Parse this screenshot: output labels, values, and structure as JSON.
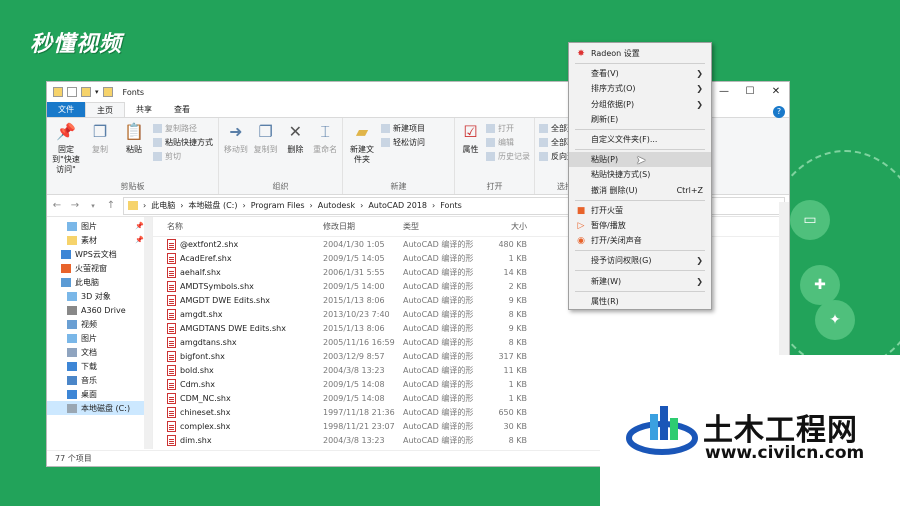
{
  "brand": "秒懂视频",
  "watermark": {
    "title": "土木工程网",
    "url": "www.civilcn.com"
  },
  "window": {
    "title": "Fonts",
    "controls": {
      "minimize": "—",
      "maximize": "☐",
      "close": "✕"
    },
    "tabs": [
      "文件",
      "主页",
      "共享",
      "查看"
    ],
    "ribbon": {
      "clipboard": {
        "name": "剪贴板",
        "pin": "固定到\"快速访问\"",
        "copy": "复制",
        "paste": "粘贴",
        "cut": "剪切",
        "copy_path": "复制路径",
        "paste_shortcut": "粘贴快捷方式"
      },
      "organize": {
        "name": "组织",
        "move_to": "移动到",
        "copy_to": "复制到",
        "delete": "删除",
        "rename": "重命名"
      },
      "new": {
        "name": "新建",
        "new_folder": "新建文件夹",
        "new_item": "新建项目",
        "easy_access": "轻松访问"
      },
      "open": {
        "name": "打开",
        "properties": "属性",
        "open": "打开",
        "edit": "编辑",
        "history": "历史记录"
      },
      "select": {
        "name": "选择",
        "select_all": "全部选择",
        "select_none": "全部取消",
        "invert": "反向选择"
      }
    },
    "address": [
      "此电脑",
      "本地磁盘 (C:)",
      "Program Files",
      "Autodesk",
      "AutoCAD 2018",
      "Fonts"
    ],
    "sidebar": [
      {
        "label": "图片",
        "pinned": true,
        "color": "#7ab7e8"
      },
      {
        "label": "素材",
        "pinned": true,
        "color": "#f6d36b"
      },
      {
        "label": "WPS云文档",
        "color": "#3d86d6",
        "top": true
      },
      {
        "label": "火萤视窗",
        "color": "#e8632b",
        "top": true
      },
      {
        "label": "此电脑",
        "color": "#5b9bd5",
        "top": true
      },
      {
        "label": "3D 对象",
        "color": "#7ab7e8"
      },
      {
        "label": "A360 Drive",
        "color": "#888888"
      },
      {
        "label": "视频",
        "color": "#6a9fd3"
      },
      {
        "label": "图片",
        "color": "#7ab7e8"
      },
      {
        "label": "文档",
        "color": "#8fa4bf"
      },
      {
        "label": "下载",
        "color": "#3d86d6"
      },
      {
        "label": "音乐",
        "color": "#4b86c8"
      },
      {
        "label": "桌面",
        "color": "#3d86d6"
      },
      {
        "label": "本地磁盘 (C:)",
        "color": "#9aa7b3",
        "selected": true
      }
    ],
    "columns": {
      "name": "名称",
      "date": "修改日期",
      "type": "类型",
      "size": "大小"
    },
    "files": [
      {
        "name": "@extfont2.shx",
        "date": "2004/1/30 1:05",
        "type": "AutoCAD 编译的形",
        "size": "480 KB"
      },
      {
        "name": "AcadEref.shx",
        "date": "2009/1/5 14:05",
        "type": "AutoCAD 编译的形",
        "size": "1 KB"
      },
      {
        "name": "aehalf.shx",
        "date": "2006/1/31 5:55",
        "type": "AutoCAD 编译的形",
        "size": "14 KB"
      },
      {
        "name": "AMDTSymbols.shx",
        "date": "2009/1/5 14:00",
        "type": "AutoCAD 编译的形",
        "size": "2 KB"
      },
      {
        "name": "AMGDT DWE Edits.shx",
        "date": "2015/1/13 8:06",
        "type": "AutoCAD 编译的形",
        "size": "9 KB"
      },
      {
        "name": "amgdt.shx",
        "date": "2013/10/23 7:40",
        "type": "AutoCAD 编译的形",
        "size": "8 KB"
      },
      {
        "name": "AMGDTANS DWE Edits.shx",
        "date": "2015/1/13 8:06",
        "type": "AutoCAD 编译的形",
        "size": "9 KB"
      },
      {
        "name": "amgdtans.shx",
        "date": "2005/11/16 16:59",
        "type": "AutoCAD 编译的形",
        "size": "8 KB"
      },
      {
        "name": "bigfont.shx",
        "date": "2003/12/9 8:57",
        "type": "AutoCAD 编译的形",
        "size": "317 KB"
      },
      {
        "name": "bold.shx",
        "date": "2004/3/8 13:23",
        "type": "AutoCAD 编译的形",
        "size": "11 KB"
      },
      {
        "name": "Cdm.shx",
        "date": "2009/1/5 14:08",
        "type": "AutoCAD 编译的形",
        "size": "1 KB"
      },
      {
        "name": "CDM_NC.shx",
        "date": "2009/1/5 14:08",
        "type": "AutoCAD 编译的形",
        "size": "1 KB"
      },
      {
        "name": "chineset.shx",
        "date": "1997/11/18 21:36",
        "type": "AutoCAD 编译的形",
        "size": "650 KB"
      },
      {
        "name": "complex.shx",
        "date": "1998/11/21 23:07",
        "type": "AutoCAD 编译的形",
        "size": "30 KB"
      },
      {
        "name": "dim.shx",
        "date": "2004/3/8 13:23",
        "type": "AutoCAD 编译的形",
        "size": "8 KB"
      }
    ],
    "status": "77 个项目"
  },
  "context_menu": [
    {
      "label": "Radeon 设置",
      "icon": "radeon-icon"
    },
    {
      "sep": true
    },
    {
      "label": "查看(V)",
      "arrow": true
    },
    {
      "label": "排序方式(O)",
      "arrow": true
    },
    {
      "label": "分组依据(P)",
      "arrow": true
    },
    {
      "label": "刷新(E)"
    },
    {
      "sep": true
    },
    {
      "label": "自定义文件夹(F)..."
    },
    {
      "sep": true
    },
    {
      "label": "粘贴(P)",
      "highlight": true
    },
    {
      "label": "粘贴快捷方式(S)"
    },
    {
      "label": "撤消 删除(U)",
      "shortcut": "Ctrl+Z"
    },
    {
      "sep": true
    },
    {
      "label": "打开火萤",
      "icon": "firefly-icon"
    },
    {
      "label": "暂停/播放",
      "icon": "play-icon"
    },
    {
      "label": "打开/关闭声音",
      "icon": "sound-icon"
    },
    {
      "sep": true
    },
    {
      "label": "授予访问权限(G)",
      "arrow": true
    },
    {
      "sep": true
    },
    {
      "label": "新建(W)",
      "arrow": true
    },
    {
      "sep": true
    },
    {
      "label": "属性(R)"
    }
  ]
}
